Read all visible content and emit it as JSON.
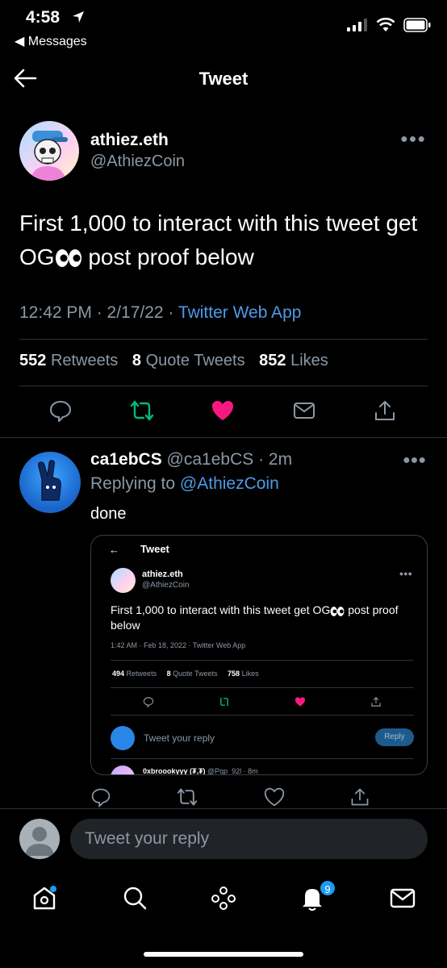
{
  "status_bar": {
    "time": "4:58",
    "back_app": "◀ Messages"
  },
  "header": {
    "title": "Tweet"
  },
  "tweet": {
    "author_name": "athiez.eth",
    "author_handle": "@AthiezCoin",
    "text_before": "First 1,000 to interact with this tweet get OG",
    "text_after": " post proof below",
    "time": "12:42 PM · 2/17/22 · ",
    "app": "Twitter Web App",
    "retweets_count": "552",
    "retweets_label": "Retweets",
    "quotes_count": "8",
    "quotes_label": "Quote Tweets",
    "likes_count": "852",
    "likes_label": "Likes"
  },
  "reply": {
    "name": "ca1ebCS",
    "handle_time": " @ca1ebCS · 2m",
    "replying_prefix": "Replying to ",
    "replying_to": "@AthiezCoin",
    "text": "done"
  },
  "embed": {
    "back": "←",
    "title": "Tweet",
    "author_name": "athiez.eth",
    "author_handle": "@AthiezCoin",
    "text_before": "First 1,000 to interact with this tweet get OG",
    "text_after": " post proof below",
    "meta": "1:42 AM · Feb 18, 2022 · Twitter Web App",
    "retweets_count": "494",
    "retweets_label": "Retweets",
    "quotes_count": "8",
    "quotes_label": "Quote Tweets",
    "likes_count": "758",
    "likes_label": "Likes",
    "reply_placeholder": "Tweet your reply",
    "reply_button": "Reply",
    "next_name": "0xbroookyyy (₮,₮)",
    "next_handle": " @Pgp_92l · 8m"
  },
  "compose": {
    "placeholder": "Tweet your reply"
  },
  "tabbar": {
    "notifications_badge": "9"
  },
  "colors": {
    "accent": "#1d9bf0",
    "retweet": "#00ba7c",
    "like": "#f91880",
    "muted": "#8b98a5"
  }
}
